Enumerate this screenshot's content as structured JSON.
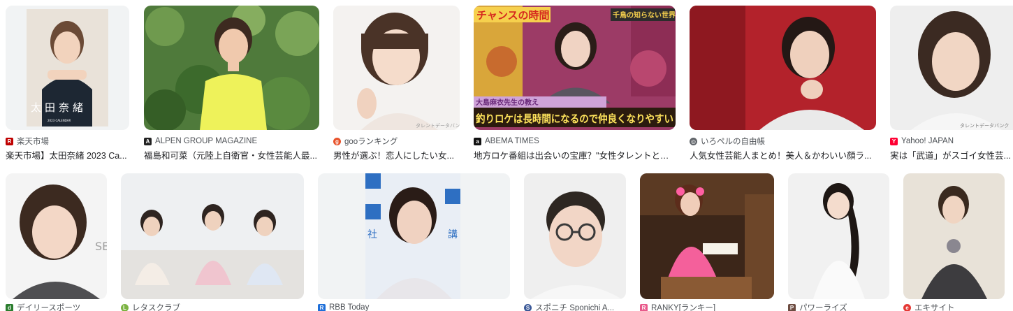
{
  "results": [
    {
      "source": "楽天市場",
      "title": "楽天市場】太田奈緒 2023 Ca...",
      "favicon": "rakuten-icon",
      "fav_color": "#bf0000",
      "fav_glyph": "R"
    },
    {
      "source": "ALPEN GROUP MAGAZINE",
      "title": "福島和可菜（元陸上自衛官・女性芸能人最...",
      "favicon": "alpen-icon",
      "fav_color": "#222222",
      "fav_glyph": "A"
    },
    {
      "source": "gooランキング",
      "title": "男性が選ぶ！恋人にしたい女...",
      "favicon": "goo-icon",
      "fav_color": "#e8532b",
      "fav_glyph": "g"
    },
    {
      "source": "ABEMA TIMES",
      "title": "地方ロケ番組は出会いの宝庫？\"女性タレントとの...",
      "favicon": "abema-icon",
      "fav_color": "#111111",
      "fav_glyph": "a"
    },
    {
      "source": "いろペルの自由帳",
      "title": "人気女性芸能人まとめ！美人＆かわいい顔ラ...",
      "favicon": "globe-icon",
      "fav_color": "#5f6368",
      "fav_glyph": "◎"
    },
    {
      "source": "Yahoo! JAPAN",
      "title": "実は「武道」がスゴイ女性芸...",
      "favicon": "yahoo-icon",
      "fav_color": "#ff0033",
      "fav_glyph": "Y"
    },
    {
      "source": "デイリースポーツ",
      "title": "",
      "favicon": "daily-sports-icon",
      "fav_color": "#2a7d2e",
      "fav_glyph": "d"
    },
    {
      "source": "レタスクラブ",
      "title": "",
      "favicon": "lettuce-club-icon",
      "fav_color": "#7cb342",
      "fav_glyph": "L"
    },
    {
      "source": "RBB Today",
      "title": "",
      "favicon": "rbb-icon",
      "fav_color": "#1e6fd9",
      "fav_glyph": "R"
    },
    {
      "source": "スポニチ Sponichi A...",
      "title": "",
      "favicon": "sponichi-icon",
      "fav_color": "#3b5998",
      "fav_glyph": "S"
    },
    {
      "source": "RANKY[ランキー]",
      "title": "",
      "favicon": "ranky-icon",
      "fav_color": "#e85a8b",
      "fav_glyph": "R"
    },
    {
      "source": "パワーライズ",
      "title": "",
      "favicon": "powerrise-icon",
      "fav_color": "#6d4c41",
      "fav_glyph": "P"
    },
    {
      "source": "エキサイト",
      "title": "",
      "favicon": "excite-icon",
      "fav_color": "#e53935",
      "fav_glyph": "e"
    }
  ],
  "overlays": {
    "calendar_name": "太田奈緒",
    "calendar_sub": "2023 CALENDAR",
    "abema_top": "チャンスの時間",
    "abema_corner": "千鳥の知らない世界",
    "abema_small": "大島麻衣先生の教え",
    "abema_caption": "釣りロケは長時間になるので仲良くなりやすい",
    "watermark_talent": "タレントデータバンク",
    "rbb_left": "社",
    "rbb_right": "講"
  },
  "colors": {
    "card_bg": "#f1f3f4",
    "text": "#202124",
    "source_text": "#4d5156"
  }
}
